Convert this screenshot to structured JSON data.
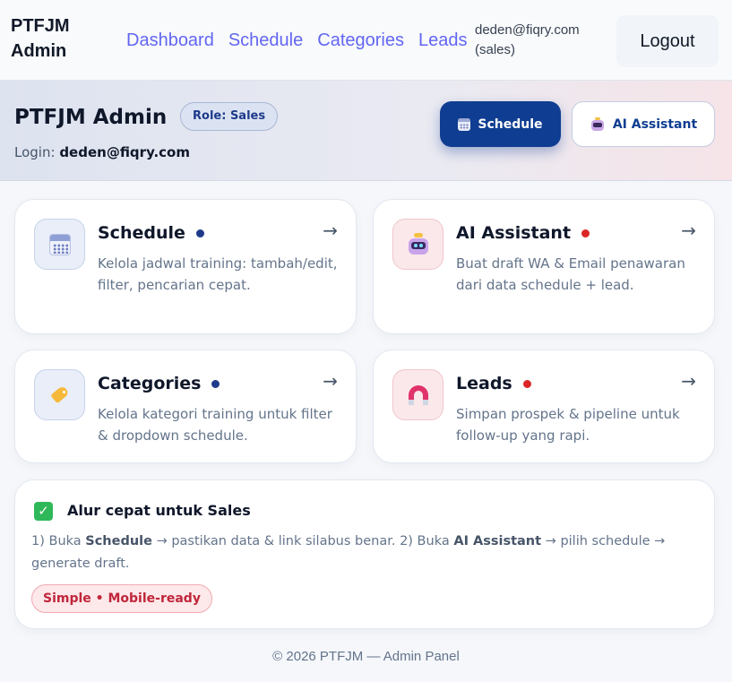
{
  "nav": {
    "brand": "PTFJM Admin",
    "links": [
      "Dashboard",
      "Schedule",
      "Categories",
      "Leads"
    ],
    "user_email": "deden@fiqry.com",
    "user_role": "(sales)",
    "logout": "Logout"
  },
  "hero": {
    "title": "PTFJM Admin",
    "role_badge": "Role: Sales",
    "login_label": "Login:",
    "login_value": "deden@fiqry.com",
    "schedule_button": "Schedule",
    "ai_button": "AI Assistant"
  },
  "cards": [
    {
      "title": "Schedule",
      "desc": "Kelola jadwal training: tambah/edit, filter, pencarian cepat.",
      "arrow": "→",
      "icon": "calendar-icon",
      "dot_color": "#1e3a8a"
    },
    {
      "title": "AI Assistant",
      "desc": "Buat draft WA & Email penawaran dari data schedule + lead.",
      "arrow": "→",
      "icon": "robot-icon",
      "dot_color": "#dc2626"
    },
    {
      "title": "Categories",
      "desc": "Kelola kategori training untuk filter & dropdown schedule.",
      "arrow": "→",
      "icon": "tag-icon",
      "dot_color": "#1e3a8a"
    },
    {
      "title": "Leads",
      "desc": "Simpan prospek & pipeline untuk follow-up yang rapi.",
      "arrow": "→",
      "icon": "magnet-icon",
      "dot_color": "#dc2626"
    }
  ],
  "flow": {
    "check": "✓",
    "title": "Alur cepat untuk Sales",
    "t1": "1) Buka ",
    "b1": "Schedule",
    "t2": " → pastikan data & link silabus benar. 2) Buka ",
    "b2": "AI Assistant",
    "t3": " → pilih schedule → generate draft.",
    "pill": "Simple • Mobile-ready"
  },
  "footer": "© 2026 PTFJM — Admin Panel",
  "colors": {
    "primary": "#0f3d91",
    "link": "#6366f1",
    "accent_red": "#dc2626"
  }
}
